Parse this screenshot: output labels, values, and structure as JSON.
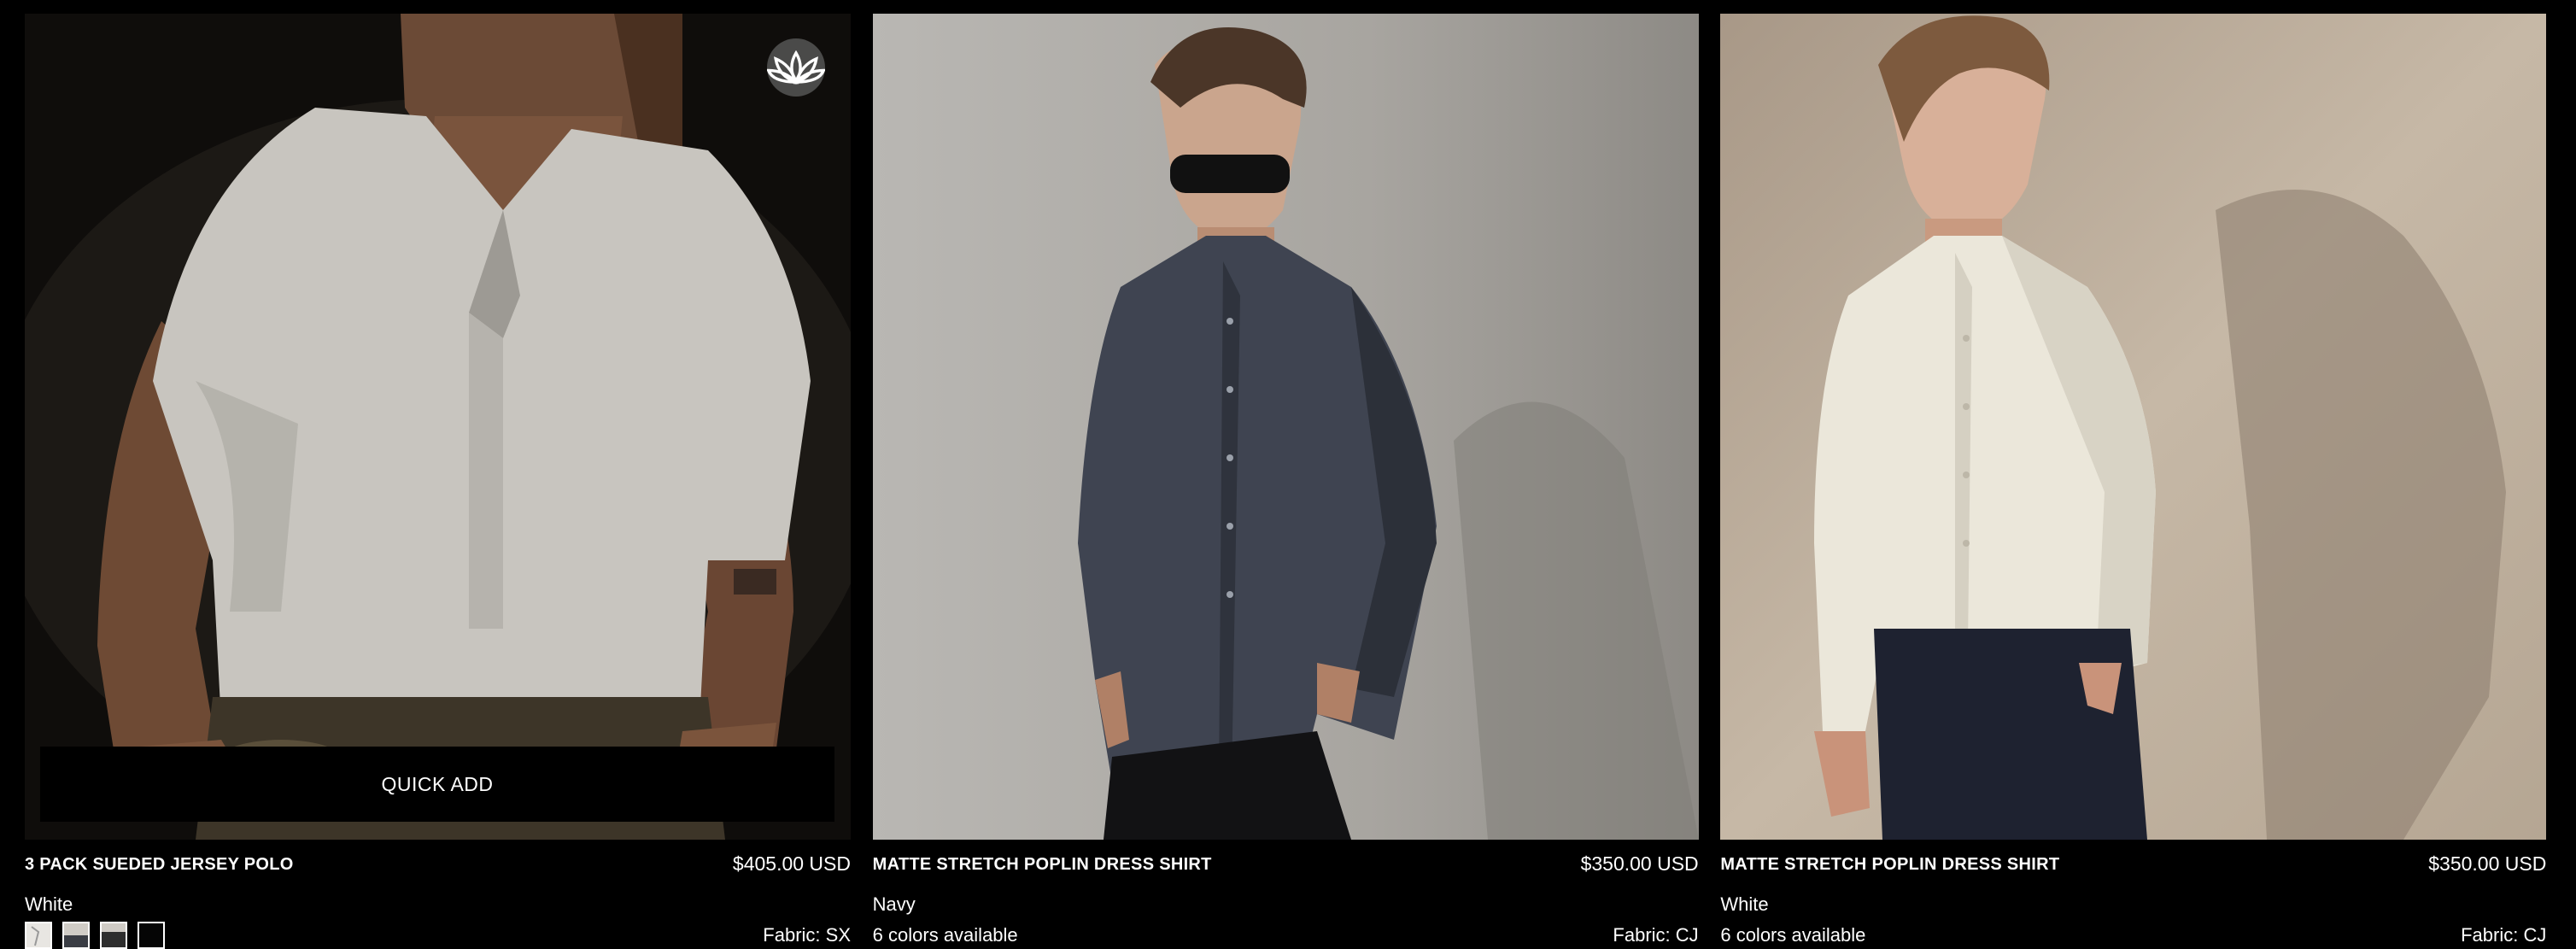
{
  "products": [
    {
      "title": "3 PACK SUEDED JERSEY POLO",
      "price": "$405.00 USD",
      "color": "White",
      "fabric": "Fabric: SX",
      "quick_add": "QUICK ADD",
      "image_icon": "lotus-icon",
      "swatches": [
        "white-polo-swatch",
        "navy-grey-polo-swatch",
        "black-grey-polo-swatch",
        "black-polo-swatch"
      ]
    },
    {
      "title": "MATTE STRETCH POPLIN DRESS SHIRT",
      "price": "$350.00 USD",
      "color": "Navy",
      "availability": "6 colors available",
      "fabric": "Fabric: CJ"
    },
    {
      "title": "MATTE STRETCH POPLIN DRESS SHIRT",
      "price": "$350.00 USD",
      "color": "White",
      "availability": "6 colors available",
      "fabric": "Fabric: CJ"
    }
  ],
  "colors": {
    "background": "#000000",
    "text": "#ffffff"
  }
}
